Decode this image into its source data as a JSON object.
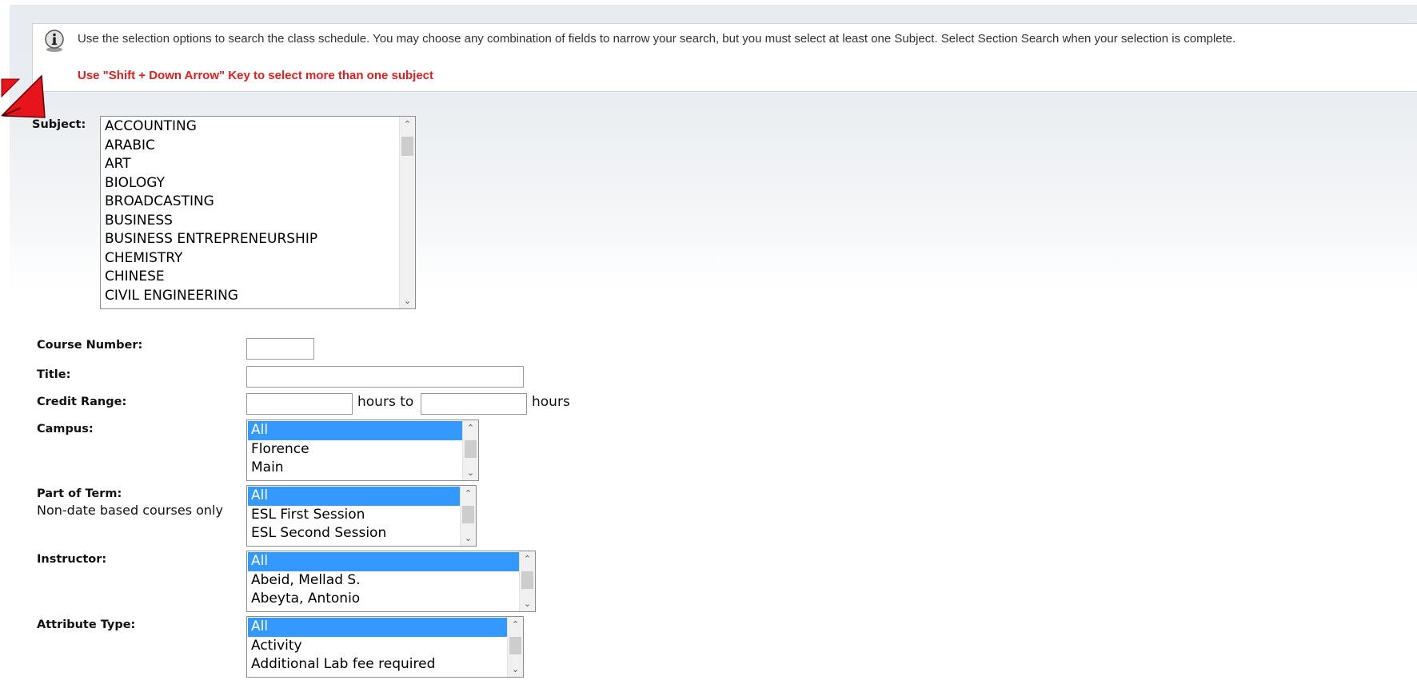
{
  "instructions": {
    "text": "Use the selection options to search the class schedule. You may choose any combination of fields to narrow your search, but you must select at least one Subject. Select Section Search when your selection is complete.",
    "hint": "Use \"Shift + Down Arrow\" Key to select more than one subject"
  },
  "icons": {
    "info": "info-icon",
    "arrow": "red-arrow-pointer",
    "scroll_up": "chevron-up-icon",
    "scroll_down": "chevron-down-icon"
  },
  "colors": {
    "hint": "#e02020",
    "selection": "#3399ff",
    "arrow": "#e8141b"
  },
  "subject": {
    "label": "Subject:",
    "options": [
      "ACCOUNTING",
      "ARABIC",
      "ART",
      "BIOLOGY",
      "BROADCASTING",
      "BUSINESS",
      "BUSINESS ENTREPRENEURSHIP",
      "CHEMISTRY",
      "CHINESE",
      "CIVIL ENGINEERING"
    ]
  },
  "course_number": {
    "label": "Course Number:",
    "value": ""
  },
  "title": {
    "label": "Title:",
    "value": ""
  },
  "credit_range": {
    "label": "Credit Range:",
    "from": "",
    "to": "",
    "mid_text": "hours to",
    "end_text": "hours"
  },
  "campus": {
    "label": "Campus:",
    "options": [
      "All",
      "Florence",
      "Main"
    ],
    "selected": "All"
  },
  "part_of_term": {
    "label": "Part of Term:",
    "sublabel": "Non-date based courses only",
    "options": [
      "All",
      "ESL First Session",
      "ESL Second Session"
    ],
    "selected": "All"
  },
  "instructor": {
    "label": "Instructor:",
    "options": [
      "All",
      "Abeid, Mellad S.",
      "Abeyta, Antonio"
    ],
    "selected": "All"
  },
  "attribute_type": {
    "label": "Attribute Type:",
    "options": [
      "All",
      "Activity",
      "Additional Lab fee required"
    ],
    "selected": "All"
  }
}
